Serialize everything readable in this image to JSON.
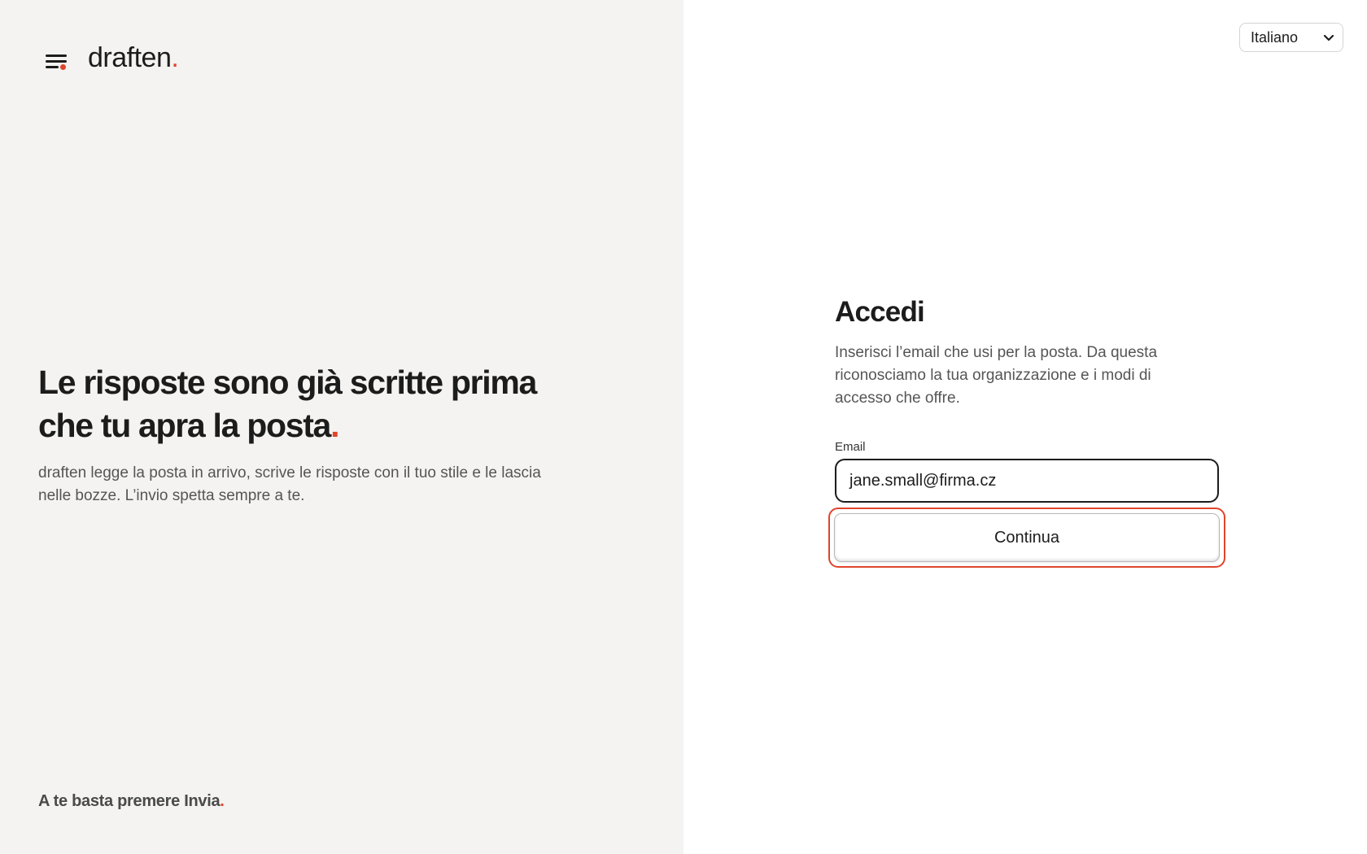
{
  "brand": {
    "name": "draften",
    "dot": "."
  },
  "hero": {
    "headline": "Le risposte sono già scritte prima che tu apra la posta",
    "headline_dot": ".",
    "description": "draften legge la posta in arrivo, scrive le risposte con il tuo stile e le lascia nelle bozze. L’invio spetta sempre a te."
  },
  "tagline": {
    "text": "A te basta premere Invia",
    "dot": "."
  },
  "language": {
    "selected": "Italiano"
  },
  "login": {
    "title": "Accedi",
    "description": "Inserisci l’email che usi per la posta. Da questa riconosciamo la tua organizzazione e i modi di accesso che offre.",
    "email_label": "Email",
    "email_value": "jane.small@firma.cz",
    "continue_label": "Continua"
  },
  "colors": {
    "accent": "#e0442a",
    "left_bg": "#f4f3f1",
    "text": "#1c1c1c"
  },
  "icons": {
    "logo": "menu-lines-icon",
    "language_chevron": "chevron-down-icon"
  }
}
